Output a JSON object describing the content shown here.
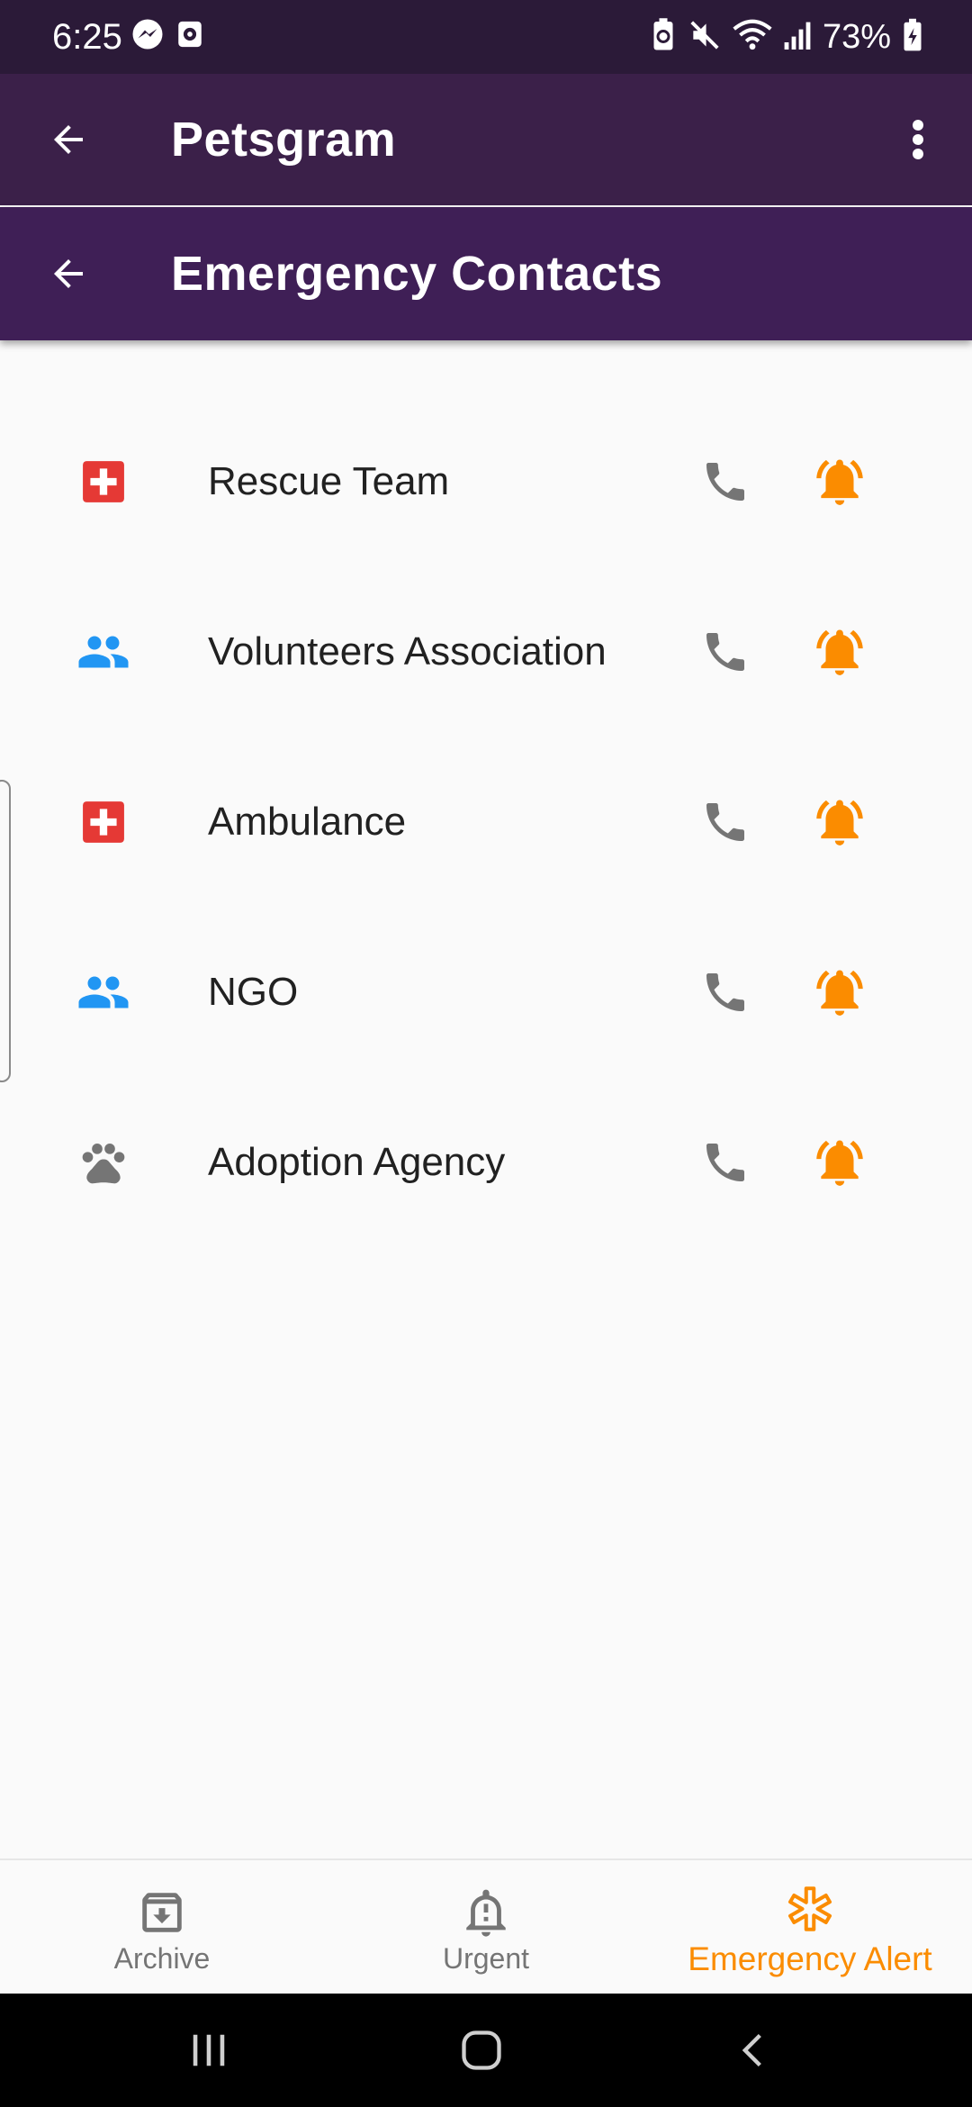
{
  "status_bar": {
    "time": "6:25",
    "battery_percent": "73%",
    "icons": [
      "messenger-icon",
      "screen-record-icon",
      "battery-saver-icon",
      "mute-icon",
      "wifi-icon",
      "signal-icon",
      "battery-icon"
    ]
  },
  "app_bar": {
    "title": "Petsgram",
    "back_icon": "arrow-back-icon",
    "menu_icon": "more-vert-icon"
  },
  "sub_bar": {
    "title": "Emergency Contacts",
    "back_icon": "arrow-back-icon"
  },
  "contacts": [
    {
      "name": "Rescue Team",
      "icon": "medical-cross-icon"
    },
    {
      "name": "Volunteers Association",
      "icon": "people-icon"
    },
    {
      "name": "Ambulance",
      "icon": "medical-cross-icon"
    },
    {
      "name": "NGO",
      "icon": "people-icon"
    },
    {
      "name": "Adoption Agency",
      "icon": "paw-icon"
    }
  ],
  "contact_actions": {
    "call_icon": "phone-icon",
    "alert_icon": "alarm-bell-icon"
  },
  "bottom_nav": {
    "items": [
      {
        "label": "Archive",
        "icon": "archive-icon",
        "active": false
      },
      {
        "label": "Urgent",
        "icon": "notification-important-icon",
        "active": false
      },
      {
        "label": "Emergency Alert",
        "icon": "asterisk-icon",
        "active": true
      }
    ]
  },
  "colors": {
    "status_bar": "#2b1a38",
    "app_bar": "#3b2049",
    "sub_bar": "#3f1f56",
    "background": "#fafafa",
    "medical_red": "#e53935",
    "people_blue": "#2196f3",
    "icon_gray": "#757575",
    "alert_orange": "#fb8c00"
  }
}
